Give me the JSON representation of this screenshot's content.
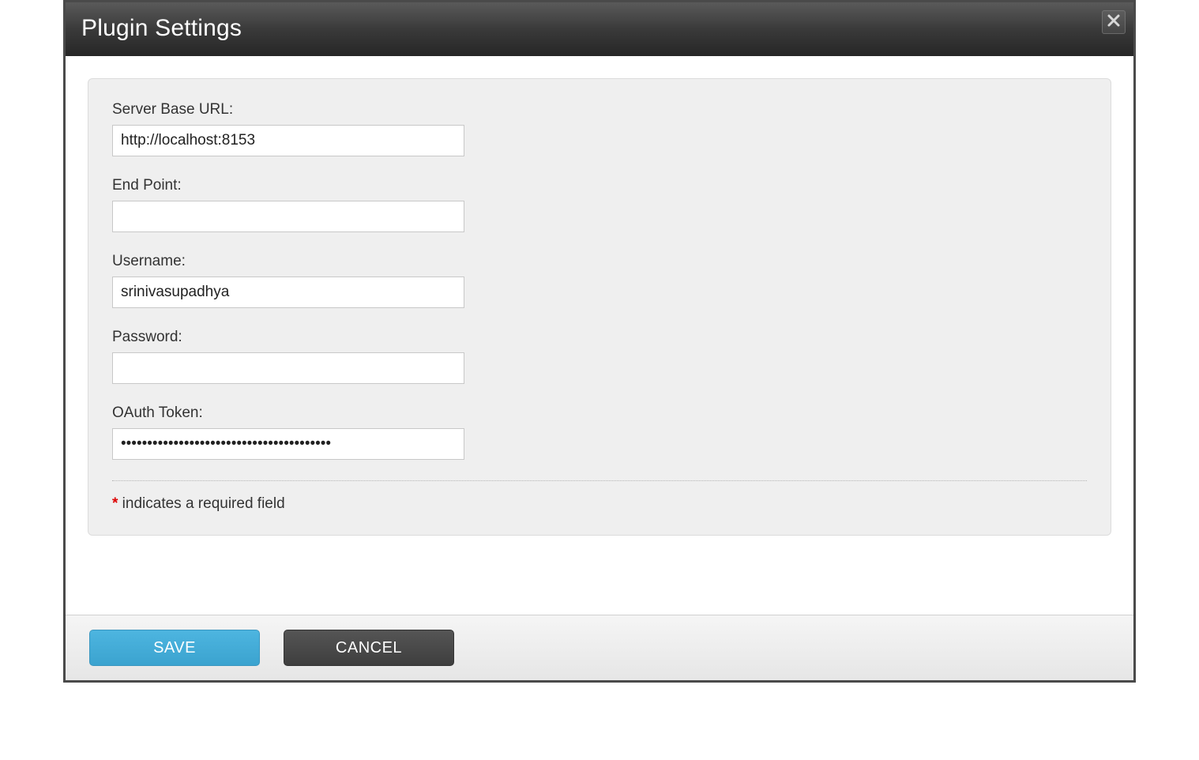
{
  "modal": {
    "title": "Plugin Settings"
  },
  "form": {
    "serverBaseUrl": {
      "label": "Server Base URL:",
      "value": "http://localhost:8153"
    },
    "endPoint": {
      "label": "End Point:",
      "value": ""
    },
    "username": {
      "label": "Username:",
      "value": "srinivasupadhya"
    },
    "password": {
      "label": "Password:",
      "value": ""
    },
    "oauthToken": {
      "label": "OAuth Token:",
      "value": "••••••••••••••••••••••••••••••••••••••••"
    },
    "requiredNote": {
      "star": "*",
      "text": " indicates a required field"
    }
  },
  "footer": {
    "saveLabel": "SAVE",
    "cancelLabel": "CANCEL"
  }
}
